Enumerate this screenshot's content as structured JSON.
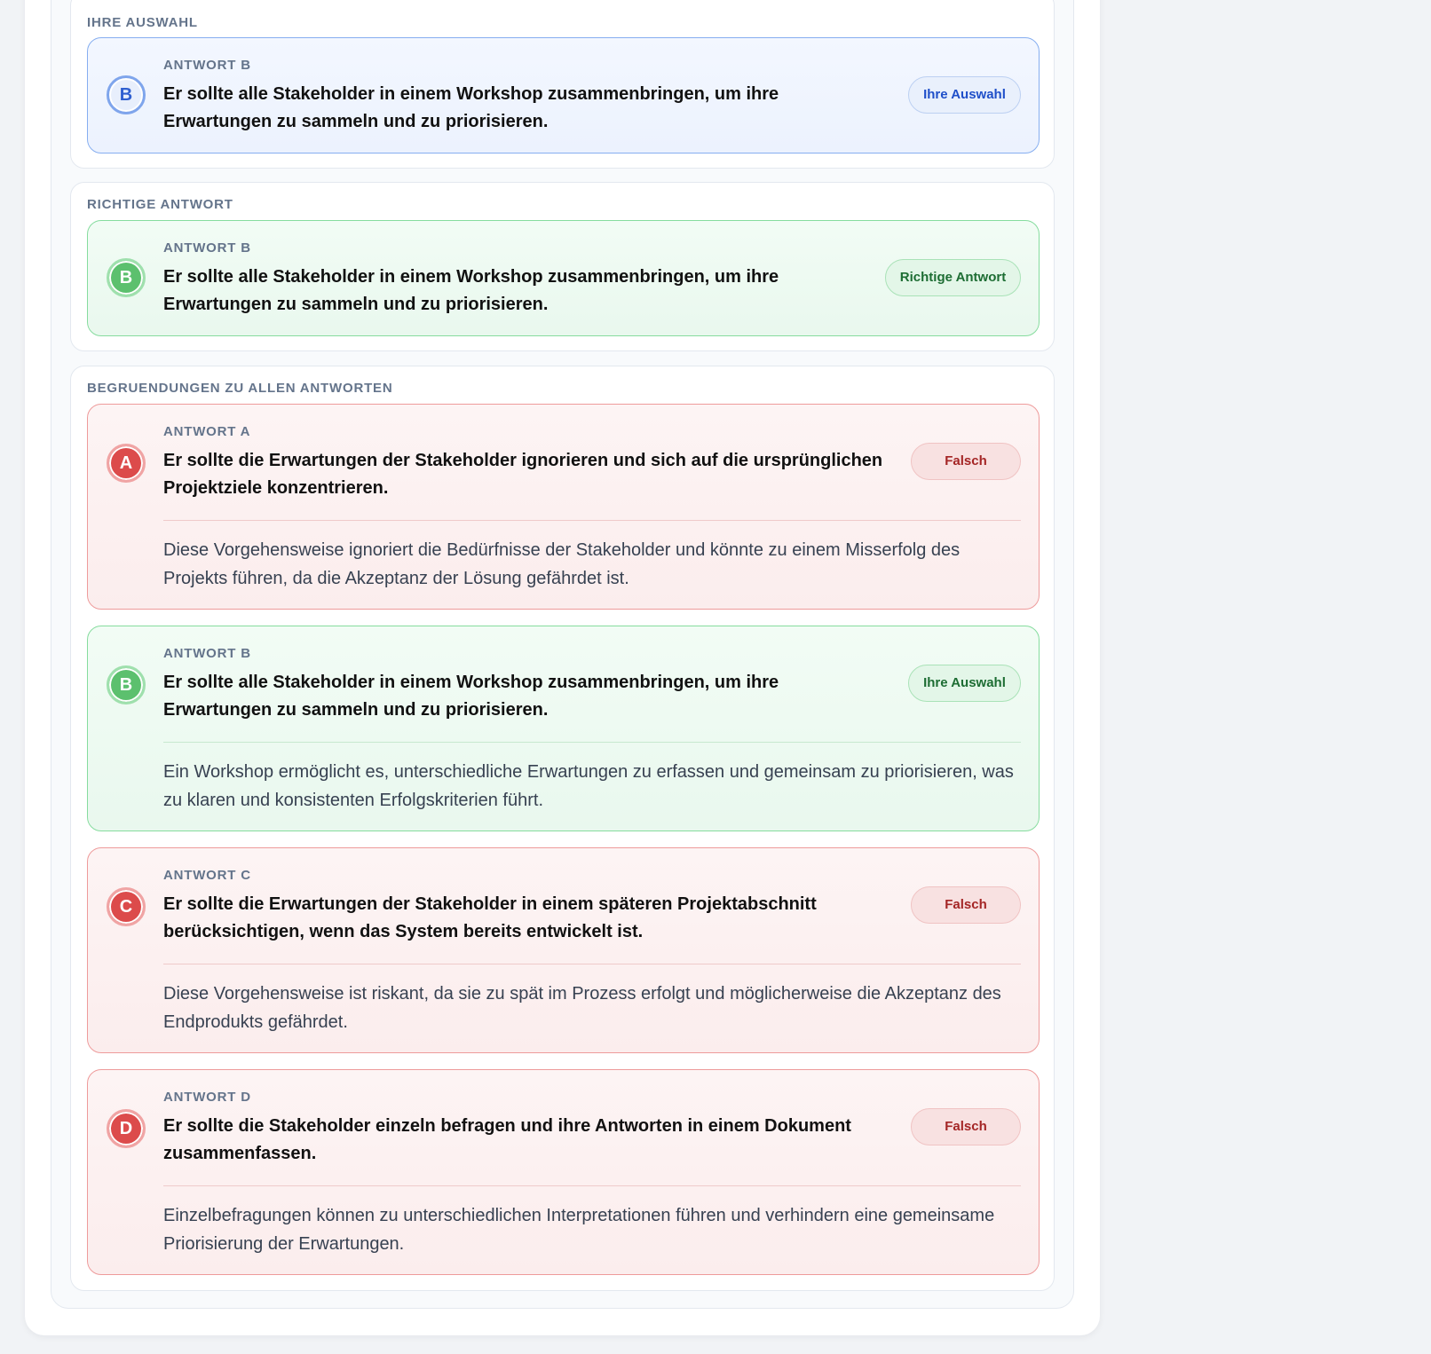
{
  "selected_section": {
    "title": "IHRE AUSWAHL",
    "answer": {
      "letter": "B",
      "label": "ANTWORT B",
      "text": "Er sollte alle Stakeholder in einem Workshop zusammenbringen, um ihre Erwartungen zu sammeln und zu priorisieren.",
      "badge": "Ihre Auswahl",
      "status_color": "#2f5fd0"
    }
  },
  "correct_section": {
    "title": "RICHTIGE ANTWORT",
    "answer": {
      "letter": "B",
      "label": "ANTWORT B",
      "text": "Er sollte alle Stakeholder in einem Workshop zusammenbringen, um ihre Erwartungen zu sammeln und zu priorisieren.",
      "badge": "Richtige Antwort",
      "status_color": "#5cc06e"
    }
  },
  "explanations_section": {
    "title": "BEGRUENDUNGEN ZU ALLEN ANTWORTEN",
    "answers": [
      {
        "letter": "A",
        "label": "ANTWORT A",
        "text": "Er sollte die Erwartungen der Stakeholder ignorieren und sich auf die ursprünglichen Projektziele konzentrieren.",
        "badge": "Falsch",
        "explanation": "Diese Vorgehensweise ignoriert die Bedürfnisse der Stakeholder und könnte zu einem Misserfolg des Projekts führen, da die Akzeptanz der Lösung gefährdet ist.",
        "status": "wrong"
      },
      {
        "letter": "B",
        "label": "ANTWORT B",
        "text": "Er sollte alle Stakeholder in einem Workshop zusammenbringen, um ihre Erwartungen zu sammeln und zu priorisieren.",
        "badge": "Ihre Auswahl",
        "explanation": "Ein Workshop ermöglicht es, unterschiedliche Erwartungen zu erfassen und gemeinsam zu priorisieren, was zu klaren und konsistenten Erfolgskriterien führt.",
        "status": "correct"
      },
      {
        "letter": "C",
        "label": "ANTWORT C",
        "text": "Er sollte die Erwartungen der Stakeholder in einem späteren Projektabschnitt berücksichtigen, wenn das System bereits entwickelt ist.",
        "badge": "Falsch",
        "explanation": "Diese Vorgehensweise ist riskant, da sie zu spät im Prozess erfolgt und möglicherweise die Akzeptanz des Endprodukts gefährdet.",
        "status": "wrong"
      },
      {
        "letter": "D",
        "label": "ANTWORT D",
        "text": "Er sollte die Stakeholder einzeln befragen und ihre Antworten in einem Dokument zusammenfassen.",
        "badge": "Falsch",
        "explanation": "Einzelbefragungen können zu unterschiedlichen Interpretationen führen und verhindern eine gemeinsame Priorisierung der Erwartungen.",
        "status": "wrong"
      }
    ]
  },
  "colors": {
    "correct": "#5cc06e",
    "wrong": "#dc4b4b",
    "selected": "#2f5fd0"
  }
}
